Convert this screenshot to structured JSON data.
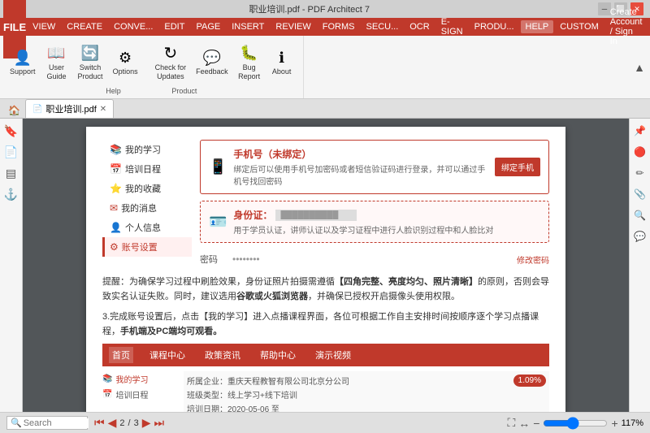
{
  "titlebar": {
    "title": "职业培训.pdf - PDF Architect 7",
    "controls": [
      "minimize",
      "restore",
      "close"
    ]
  },
  "menubar": {
    "items": [
      "FILE",
      "VIEW",
      "CREATE",
      "CONVE...",
      "EDIT",
      "PAGE",
      "INSERT",
      "REVIEW",
      "FORMS",
      "SECU...",
      "OCR",
      "E-SIGN",
      "PRODU...",
      "HELP",
      "CUSTOM"
    ],
    "create_account": "Create Account / Sign In"
  },
  "ribbon": {
    "help_group": {
      "label": "Help",
      "buttons": [
        {
          "id": "support",
          "label": "Support",
          "icon": "👤"
        },
        {
          "id": "user-guide",
          "label": "User\nGuide",
          "icon": "📖"
        },
        {
          "id": "switch-product",
          "label": "Switch\nProduct",
          "icon": "🔄"
        },
        {
          "id": "options",
          "label": "Options",
          "icon": "⚙"
        },
        {
          "id": "check-updates",
          "label": "Check for\nUpdates",
          "icon": "↻"
        },
        {
          "id": "feedback",
          "label": "Feedback",
          "icon": "💬"
        },
        {
          "id": "bug-report",
          "label": "Bug\nReport",
          "icon": "🐛"
        },
        {
          "id": "about",
          "label": "About",
          "icon": "ℹ"
        }
      ]
    },
    "product_group_label": "Product"
  },
  "tabs": [
    {
      "label": "职业培训.pdf",
      "active": true
    }
  ],
  "document": {
    "sidebar_nav": [
      {
        "label": "我的学习",
        "icon": "📚",
        "active": false
      },
      {
        "label": "培训日程",
        "icon": "📅",
        "active": false
      },
      {
        "label": "我的收藏",
        "icon": "⭐",
        "active": false
      },
      {
        "label": "我的消息",
        "icon": "✉",
        "active": false
      },
      {
        "label": "个人信息",
        "icon": "👤",
        "active": false
      },
      {
        "label": "账号设置",
        "icon": "⚙",
        "active": true
      }
    ],
    "phone_card": {
      "title": "手机号（未绑定）",
      "desc": "绑定后可以使用手机号加密码或者短信验证码进行登录，并可以通过手机号找回密码",
      "button": "绑定手机"
    },
    "id_card": {
      "title": "身份证：",
      "placeholder": "██████████",
      "desc": "用于学员认证，讲师认证以及学习证程中进行人脸识别过程中和人脸比对"
    },
    "password": {
      "label": "密码",
      "modify_link": "修改密码"
    },
    "reminder_text": "提醒：为确保学习过程中刷脸效果，身份证照片拍摄需遵循【四角完整、亮度均匀、照片清晰】的原则，否则会导致实名认证失败。同时，建议选用谷歌或火狐浏览器，并确保已授权开启摄像头使用权限。",
    "step3_text": "3.完成账号设置后，点击【我的学习】进入点播课程界面，各位可根据工作自主安排时间按顺序逐个学习点播课程，手机端及PC端均可观看。",
    "bottom_nav": [
      "首页",
      "课程中心",
      "政策资讯",
      "帮助中心",
      "演示视频"
    ],
    "bottom_nav_active": "首页",
    "bottom_left_items": [
      {
        "label": "我的学习",
        "icon": "📚",
        "active": true
      },
      {
        "label": "培训日程",
        "icon": "📅"
      }
    ],
    "bottom_right": {
      "company": "所属企业：重庆天程教智有限公司北京分公司",
      "training_type": "班级类型：线上学习+线下培训",
      "date": "培训日期：2020-05-06 至",
      "progress": "1.09%"
    }
  },
  "statusbar": {
    "search_placeholder": "Search",
    "page_current": "2",
    "page_total": "3",
    "zoom": "117%"
  }
}
